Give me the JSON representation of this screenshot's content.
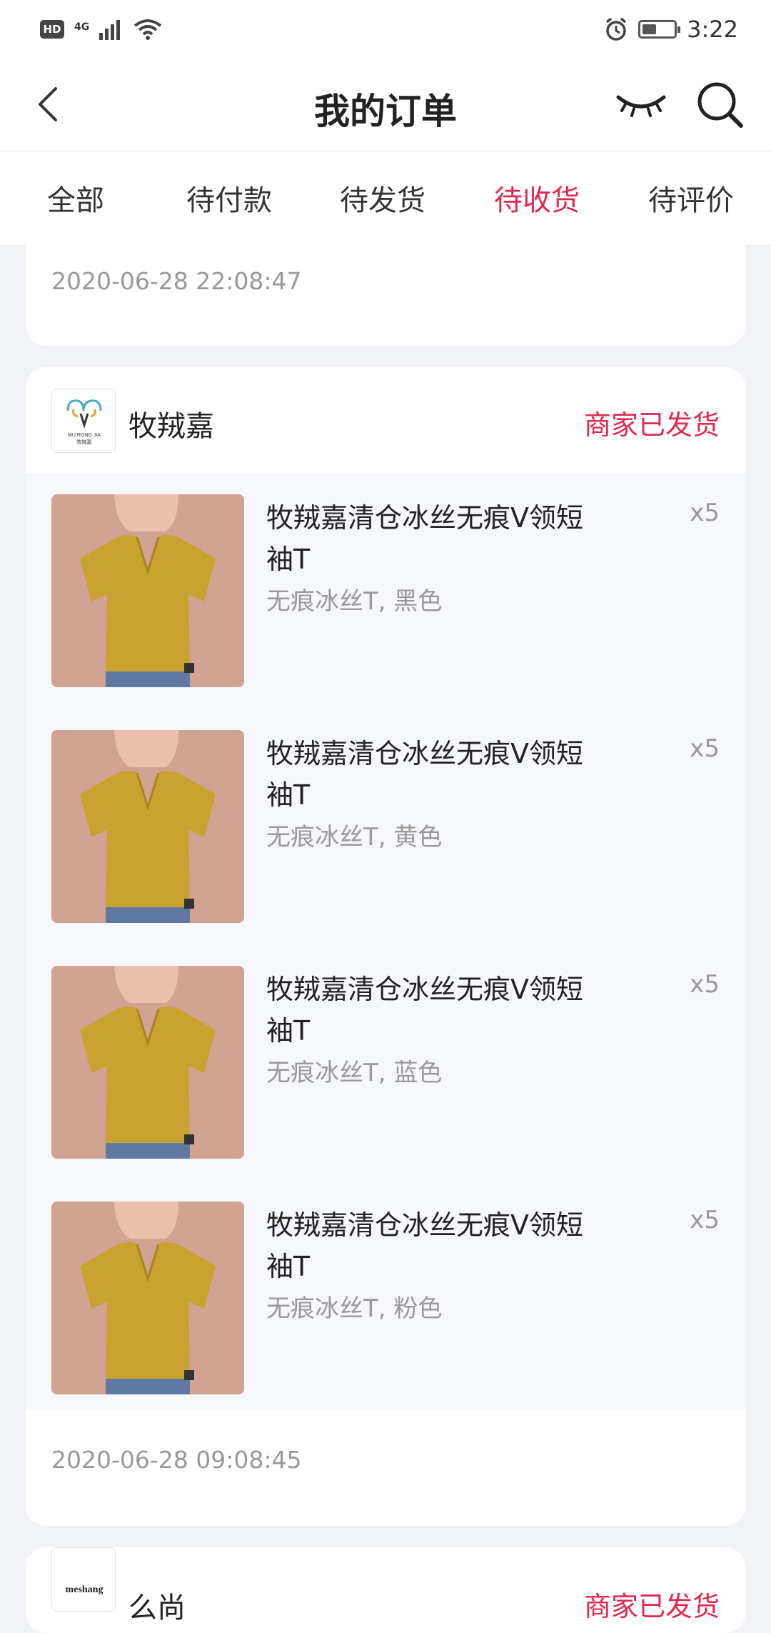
{
  "status_bar": {
    "hd": "HD",
    "network": "4G",
    "time": "3:22",
    "battery_level": 0.45
  },
  "header": {
    "title": "我的订单",
    "icons": [
      "back-icon",
      "eye-closed-icon",
      "search-icon"
    ]
  },
  "tabs": [
    {
      "label": "全部",
      "active": false
    },
    {
      "label": "待付款",
      "active": false
    },
    {
      "label": "待发货",
      "active": false
    },
    {
      "label": "待收货",
      "active": true
    },
    {
      "label": "待评价",
      "active": false
    }
  ],
  "orders": [
    {
      "time": "2020-06-28 22:08:47"
    },
    {
      "shop": {
        "name": "牧羢嘉",
        "status": "商家已发货",
        "logo_text": "MU RONG JIA",
        "logo_subtext": "牧羢嘉"
      },
      "items": [
        {
          "name": "牧羢嘉清仓冰丝无痕V领短袖T",
          "spec": "无痕冰丝T, 黑色",
          "qty": "x5"
        },
        {
          "name": "牧羢嘉清仓冰丝无痕V领短袖T",
          "spec": "无痕冰丝T, 黄色",
          "qty": "x5"
        },
        {
          "name": "牧羢嘉清仓冰丝无痕V领短袖T",
          "spec": "无痕冰丝T, 蓝色",
          "qty": "x5"
        },
        {
          "name": "牧羢嘉清仓冰丝无痕V领短袖T",
          "spec": "无痕冰丝T, 粉色",
          "qty": "x5"
        }
      ],
      "time": "2020-06-28 09:08:45"
    },
    {
      "shop": {
        "name": "么尚",
        "status": "商家已发货",
        "logo_text": "meshang"
      }
    }
  ],
  "colors": {
    "accent": "#e2294f",
    "muted": "#999999",
    "background": "#f1f3f6"
  }
}
